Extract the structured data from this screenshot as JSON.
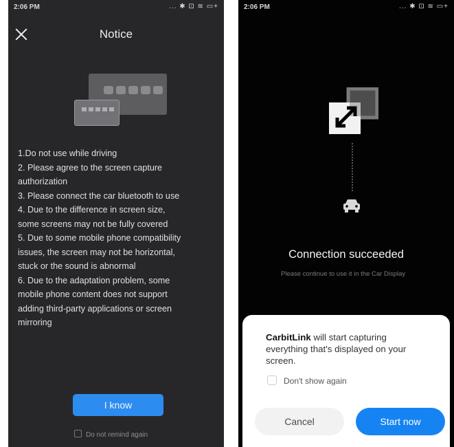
{
  "left_screen": {
    "status_bar": {
      "time": "2:06 PM",
      "icons": "... ✱ ⊡ ≋ ▭+"
    },
    "title": "Notice",
    "notices": [
      "1.Do not use while driving",
      "2. Please agree to the screen capture",
      "authorization",
      "3. Please connect the car bluetooth to use",
      "4. Due to the difference in screen size,",
      "some screens may not be fully covered",
      "5. Due to some mobile phone compatibility",
      "issues, the screen may not be horizontal,",
      "stuck or the sound is abnormal",
      "6. Due to the adaptation problem, some",
      "mobile phone content does not support",
      "adding third-party applications or screen",
      "mirroring"
    ],
    "i_know_button": "I know",
    "dont_remind_label": "Do not remind again"
  },
  "right_screen": {
    "status_bar": {
      "time": "2:06 PM",
      "icons": "... ✱ ⊡ ≋ ▭+"
    },
    "connection_title": "Connection succeeded",
    "connection_subtitle": "Please continue to use it in the Car Display",
    "dialog": {
      "app_name": "CarbitLink",
      "message": " will start capturing everything that's displayed on your screen.",
      "checkbox_label": "Don't show again",
      "cancel_button": "Cancel",
      "start_button": "Start now"
    }
  }
}
